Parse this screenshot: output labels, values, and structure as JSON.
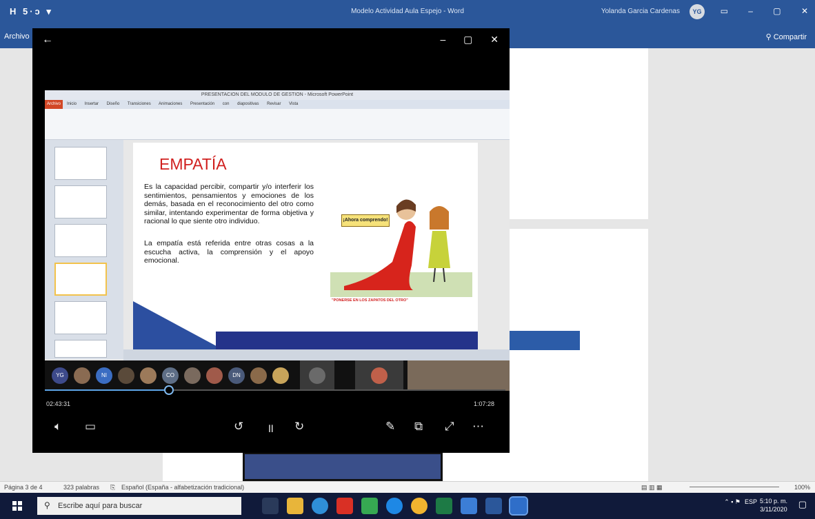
{
  "word": {
    "qat": "H 5·ↄ ▾",
    "title": "Modelo Actividad Aula Espejo - Word",
    "user": "Yolanda Garcia Cardenas",
    "user_initials": "YG",
    "tab_file": "Archivo",
    "share": "Compartir",
    "status": {
      "page": "Página 3 de 4",
      "words": "323 palabras",
      "language": "Español (España - alfabetización tradicional)",
      "zoom": "100%"
    }
  },
  "player": {
    "time_elapsed": "02:43:31",
    "time_total": "1:07:28",
    "progress_fraction": 0.27,
    "participants": [
      "YG",
      "",
      "NI",
      "",
      "",
      "CO",
      "",
      "",
      "DN",
      "",
      "",
      "",
      ""
    ]
  },
  "ppt": {
    "window_title": "PRESENTACION DEL MODULO DE GESTION - Microsoft PowerPoint",
    "file_tab": "Archivo",
    "tabs": "Inicio Insertar Diseño Transiciones Animaciones Presentación con diapositivas Revisar Vista",
    "slide_title": "EMPATÍA",
    "para1": "Es la capacidad percibir, compartir y/o interferir los sentimientos, pensamientos y emociones de los demás, basada en el reconocimiento del otro como similar, intentando experimentar de forma objetiva y racional lo que siente otro individuo.",
    "para2": "La empatía está referida entre otras cosas a la escucha activa, la comprensión y el apoyo emocional.",
    "bubble": "¡Ahora comprendo!",
    "caption": "\"PONERSE EN LOS ZAPATOS DEL OTRO\""
  },
  "taskbar": {
    "search_placeholder": "Escribe aquí para buscar",
    "time": "5:10 p. m.",
    "date": "3/11/2020",
    "lang": "ESP"
  },
  "colors": {
    "word_blue": "#2b579a",
    "taskbar": "#101a3a",
    "accent_red": "#d0201f",
    "seek": "#5ea5e8"
  }
}
